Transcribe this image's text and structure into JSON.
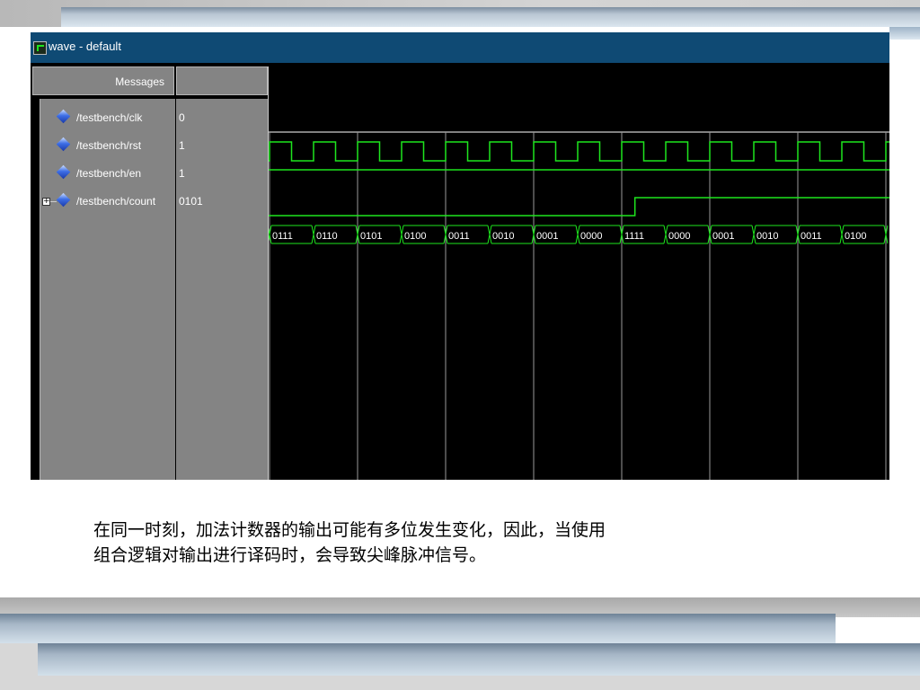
{
  "window": {
    "title": "wave - default"
  },
  "wave_header": {
    "messages_label": "Messages"
  },
  "signals": [
    {
      "name": "/testbench/clk",
      "value": "0",
      "expandable": false
    },
    {
      "name": "/testbench/rst",
      "value": "1",
      "expandable": false
    },
    {
      "name": "/testbench/en",
      "value": "1",
      "expandable": false
    },
    {
      "name": "/testbench/count",
      "value": "0101",
      "expandable": true,
      "expand_symbol": "+"
    }
  ],
  "count_values": [
    "0111",
    "0110",
    "0101",
    "0100",
    "0011",
    "0010",
    "0001",
    "0000",
    "1111",
    "0000",
    "0001",
    "0010",
    "0011",
    "0100"
  ],
  "colors": {
    "trace": "#1ee61e",
    "titlebar": "#0f4a74",
    "panel": "#848484"
  },
  "caption": {
    "line1": "在同一时刻，加法计数器的输出可能有多位发生变化，因此，当使用",
    "line2": "组合逻辑对输出进行译码时，会导致尖峰脉冲信号。"
  }
}
